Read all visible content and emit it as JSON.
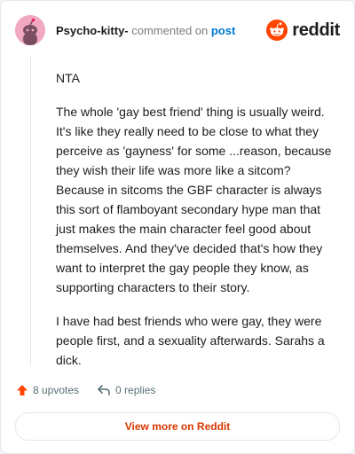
{
  "header": {
    "username": "Psycho-kitty-",
    "action_text": " commented on ",
    "post_link": "post",
    "logo_text": "reddit"
  },
  "comment": {
    "paragraphs": [
      "NTA",
      "The whole 'gay best friend' thing is usually weird. It's like they really need to be close to what they perceive as 'gayness' for some ...reason, because they wish their life was more like a sitcom? Because in sitcoms the GBF character is always this sort of flamboyant secondary hype man that just makes the main character feel good about themselves. And they've decided that's how they want to interpret the gay people they know, as supporting characters to their story.",
      "I have had best friends who were gay, they were people first, and a sexuality afterwards. Sarahs a dick."
    ]
  },
  "footer": {
    "upvotes": "8 upvotes",
    "replies": "0 replies",
    "view_more": "View more on Reddit"
  },
  "colors": {
    "brand": "#ff4500",
    "link": "#0079d3",
    "view_more": "#d93900"
  },
  "icons": {
    "avatar": "snoo-avatar-icon",
    "logo": "reddit-logo-icon",
    "upvote": "upvote-arrow-icon",
    "reply": "reply-arrow-icon"
  }
}
